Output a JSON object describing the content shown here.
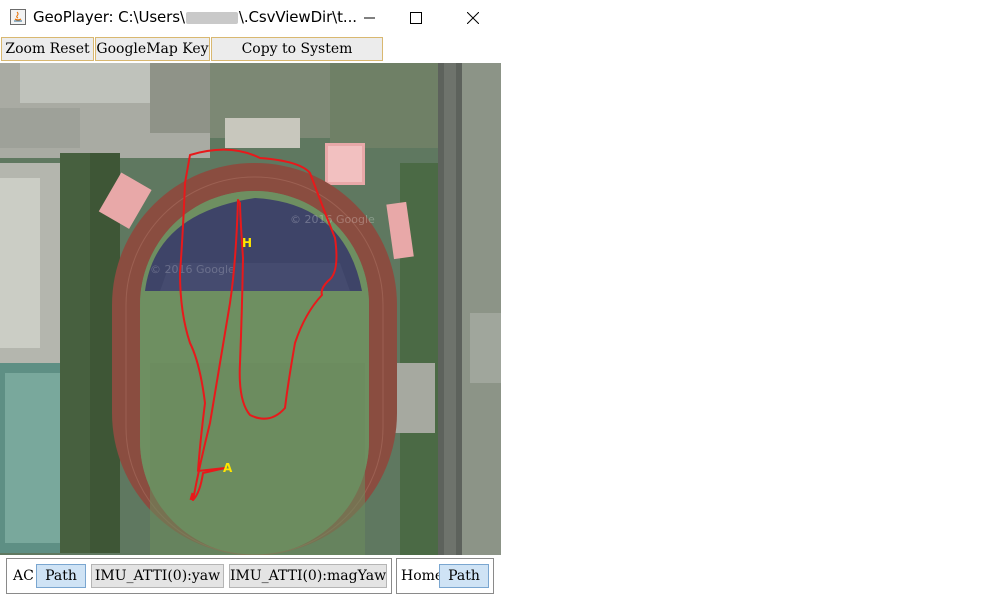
{
  "window": {
    "title_prefix": "GeoPlayer: C:\\Users\\",
    "title_suffix": "\\.CsvViewDir\\t...",
    "app_icon": "java-icon"
  },
  "toolbar": {
    "buttons": [
      "Zoom Reset",
      "GoogleMap Key",
      "Copy to System Clipboard"
    ]
  },
  "map": {
    "markers": [
      "H",
      "A"
    ],
    "watermark": "© 2016 Google",
    "path_color": "#e8191b",
    "marker_color": "#ffe600"
  },
  "bottom": {
    "ac_group": {
      "label": "AC",
      "buttons": [
        "Path",
        "IMU_ATTI(0):yaw",
        "IMU_ATTI(0):magYaw"
      ],
      "selected": "Path"
    },
    "home_group": {
      "label": "Home",
      "buttons": [
        "Path"
      ],
      "selected": "Path"
    }
  }
}
